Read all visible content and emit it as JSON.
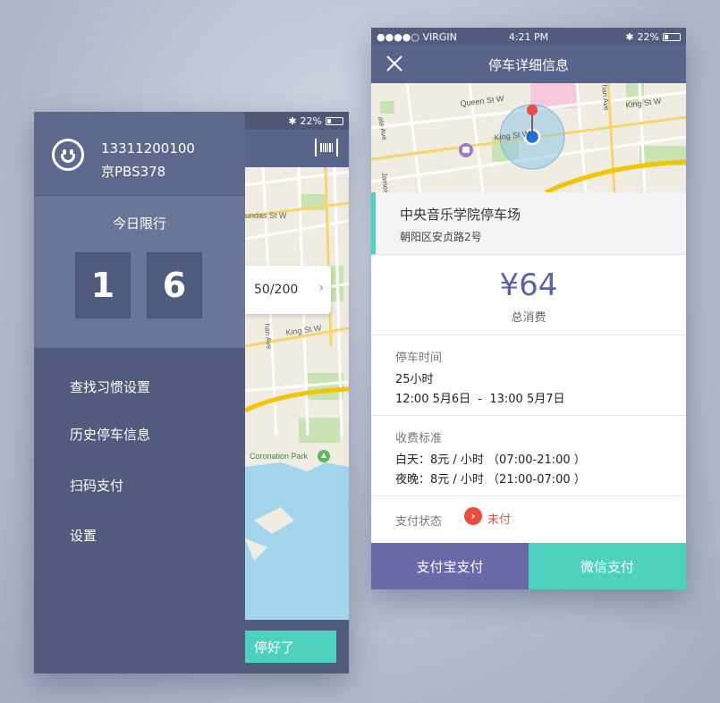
{
  "left_phone": {
    "status_bar": {
      "battery": "22%"
    },
    "drawer": {
      "phone_number": "13311200100",
      "plate": "京PBS378",
      "restriction_title": "今日限行",
      "restriction_digits": [
        "1",
        "6"
      ],
      "menu": [
        "查找习惯设置",
        "历史停车信息",
        "扫码支付",
        "设置"
      ]
    },
    "map_labels": {
      "dundas": "undas St W",
      "king": "King St W",
      "avenue": "han Ave",
      "park": "Coronation Park"
    },
    "count_card": {
      "value": "50/200"
    },
    "parked_button": "停好了"
  },
  "right_phone": {
    "status_bar": {
      "carrier": "●●●●○ VIRGIN",
      "time": "4:21 PM",
      "battery": "22%"
    },
    "nav_title": "停车详细信息",
    "map_labels": {
      "queen": "Queen St W",
      "king_left": "King St W",
      "king_right": "King St W",
      "avenue": "han Ave",
      "jameson": "Jameson",
      "dunn": "ate Ave"
    },
    "lot": {
      "name": "中央音乐学院停车场",
      "address": "朝阳区安贞路2号"
    },
    "cost": {
      "amount": "¥64",
      "label": "总消费"
    },
    "parking_time": {
      "title": "停车时间",
      "duration": "25小时",
      "range": "12:00 5月6日  -  13:00 5月7日"
    },
    "fee_standard": {
      "title": "收费标准",
      "day": "白天：8元 / 小时 （07:00-21:00 ）",
      "night": "夜晚：8元 / 小时 （21:00-07:00 ）"
    },
    "payment_status": {
      "label": "支付状态",
      "value": "未付"
    },
    "buttons": {
      "alipay": "支付宝支付",
      "wechat": "微信支付"
    }
  },
  "colors": {
    "drawer": "#505b7d",
    "accent_teal": "#4fd1bf",
    "alipay_purple": "#6b68a8",
    "unpaid_red": "#e84d3d",
    "price_purple": "#5a63a5"
  }
}
